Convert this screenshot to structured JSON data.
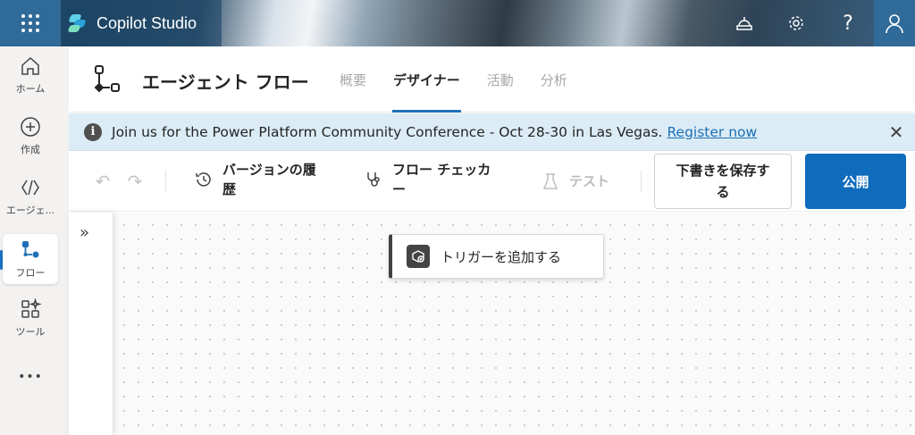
{
  "app": {
    "title": "Copilot Studio",
    "header_icons": [
      "cloud-environment-icon",
      "gear-icon",
      "help-icon",
      "person-icon"
    ],
    "help_glyph": "?"
  },
  "rail": {
    "items": [
      {
        "label": "ホーム",
        "icon": "home-icon"
      },
      {
        "label": "作成",
        "icon": "plus-circle-icon"
      },
      {
        "label": "エージェ...",
        "icon": "code-icon"
      },
      {
        "label": "フロー",
        "icon": "flow-icon",
        "active": true
      },
      {
        "label": "ツール",
        "icon": "tools-icon"
      }
    ],
    "more": "•••"
  },
  "page": {
    "title": "エージェント フロー",
    "tabs": [
      {
        "label": "概要"
      },
      {
        "label": "デザイナー",
        "active": true
      },
      {
        "label": "活動"
      },
      {
        "label": "分析"
      }
    ]
  },
  "notice": {
    "info_glyph": "i",
    "message": "Join us for the Power Platform Community Conference - Oct 28-30 in Las Vegas.",
    "link": "Register now",
    "close_glyph": "✕"
  },
  "toolbar": {
    "undo_glyph": "↶",
    "redo_glyph": "↷",
    "version_history": "バージョンの履\n歴",
    "flow_checker": "フロー チェッカ\nー",
    "test": "テスト",
    "save_draft": "下書きを保存す\nる",
    "publish": "公開"
  },
  "canvas": {
    "expand_glyph": "»",
    "trigger_label": "トリガーを追加する"
  },
  "colors": {
    "accent": "#0f6cbd",
    "tab_underline": "#2070b8",
    "notice_bg": "#dcecf6",
    "link": "#1b6fb5"
  }
}
